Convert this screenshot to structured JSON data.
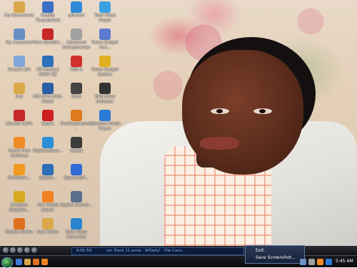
{
  "desktop_icons": [
    {
      "label": "My Documents",
      "icon": "folder-icon",
      "color": "#d9a84a"
    },
    {
      "label": "Mozilla Thunderbird",
      "icon": "thunderbird-icon",
      "color": "#3a6fc4"
    },
    {
      "label": "µTorrent",
      "icon": "utorrent-icon",
      "color": "#2f8bd8"
    },
    {
      "label": "Total Video Player",
      "icon": "video-player-icon",
      "color": "#3aa0e0"
    },
    {
      "label": "My Computer",
      "icon": "computer-icon",
      "color": "#6a8fc4"
    },
    {
      "label": "Nero StartSm...",
      "icon": "nero-icon",
      "color": "#c62828"
    },
    {
      "label": "Advanced Defragmenter",
      "icon": "defrag-icon",
      "color": "#a0a0a0"
    },
    {
      "label": "Tunes Gadget Sch...",
      "icon": "gadget-icon",
      "color": "#5a7bd0"
    },
    {
      "label": "Recycle Bin",
      "icon": "recycle-bin-icon",
      "color": "#7fa6d6"
    },
    {
      "label": "NTI Backup NOW! EZ",
      "icon": "backup-icon",
      "color": "#2d6fb8"
    },
    {
      "label": "FEM 3",
      "icon": "fem-icon",
      "color": "#d32f2f"
    },
    {
      "label": "Tunes Gadget Update",
      "icon": "gadget-update-icon",
      "color": "#e0b020"
    },
    {
      "label": "ikrs",
      "icon": "folder-icon",
      "color": "#d9a84a"
    },
    {
      "label": "NTI CD & DVD-Maker",
      "icon": "cd-maker-icon",
      "color": "#2b5fa8"
    },
    {
      "label": "iCam",
      "icon": "icam-icon",
      "color": "#444444"
    },
    {
      "label": "Web Drive Indicator",
      "icon": "web-drive-icon",
      "color": "#333333"
    },
    {
      "label": "Alcohol 120%",
      "icon": "alcohol-icon",
      "color": "#c62828"
    },
    {
      "label": "Opera",
      "icon": "opera-icon",
      "color": "#cc1f1f"
    },
    {
      "label": "DesktopCaptur...",
      "icon": "capture-icon",
      "color": "#e07a1f"
    },
    {
      "label": "Windows Media Player",
      "icon": "media-player-icon",
      "color": "#2a7bd6"
    },
    {
      "label": "Avast! Free Antivirus",
      "icon": "avast-icon",
      "color": "#f08a24"
    },
    {
      "label": "RegistryBoos...",
      "icon": "registry-icon",
      "color": "#2a8fd6"
    },
    {
      "label": "Speed",
      "icon": "speed-icon",
      "color": "#3b3b3b"
    },
    {
      "label": "",
      "icon": "blank-icon",
      "color": "#000000"
    },
    {
      "label": "DVDStyle...",
      "icon": "dvdstyler-icon",
      "color": "#f09a1f"
    },
    {
      "label": "Spybot...",
      "icon": "spybot-icon",
      "color": "#2d6fb8"
    },
    {
      "label": "SpeedUpM...",
      "icon": "speedup-icon",
      "color": "#2f6bd6"
    },
    {
      "label": "",
      "icon": "blank-icon",
      "color": "#000000"
    },
    {
      "label": "Dropbox Gadgets...",
      "icon": "dropbox-icon",
      "color": "#d7a91f"
    },
    {
      "label": "VLC media player",
      "icon": "vlc-icon",
      "color": "#f08020"
    },
    {
      "label": "Spybot Search...",
      "icon": "spybot-search-icon",
      "color": "#5a6f8a"
    },
    {
      "label": "",
      "icon": "blank-icon",
      "color": "#000000"
    },
    {
      "label": "Mozilla Firefox",
      "icon": "firefox-icon",
      "color": "#e0701f"
    },
    {
      "label": "New Folder",
      "icon": "folder-icon",
      "color": "#d9a84a"
    },
    {
      "label": "Total Video Converter",
      "icon": "video-converter-icon",
      "color": "#2a85d0"
    },
    {
      "label": "",
      "icon": "blank-icon",
      "color": "#000000"
    }
  ],
  "media_bar": {
    "time": "0:01:53",
    "now_playing": "Ian Track 11.wma - SPDefy! - File Conv...",
    "buttons": [
      "stop-icon",
      "prev-icon",
      "play-icon",
      "next-icon",
      "volume-icon"
    ]
  },
  "context_menu": {
    "items": [
      "Exit",
      "Save Screenshot..."
    ]
  },
  "taskbar": {
    "clock": "5:45 AM",
    "tray_icons": [
      "network-icon",
      "volume-icon",
      "antivirus-icon",
      "clock-icon"
    ]
  },
  "colors": {
    "taskbar_top": "#3a3d44",
    "taskbar_bottom": "#0b0c0f",
    "media_text": "#7fb6ff",
    "menu_bg": "#1f2c47"
  }
}
